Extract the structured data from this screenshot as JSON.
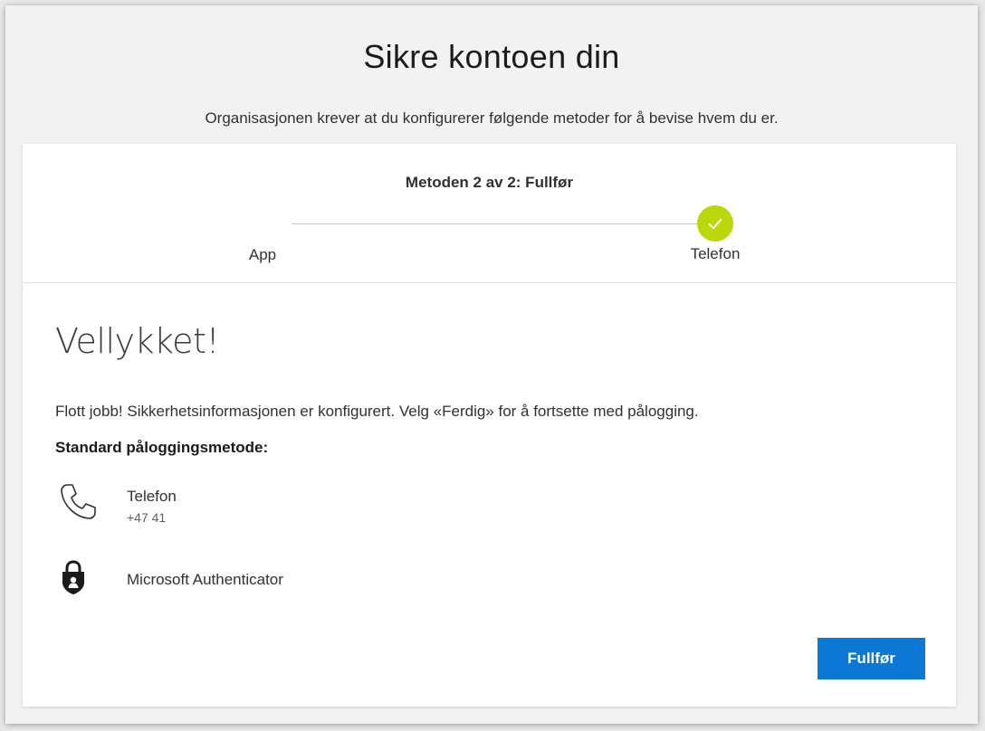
{
  "page": {
    "title": "Sikre kontoen din",
    "subtitle": "Organisasjonen krever at du konfigurerer følgende metoder for å bevise hvem du er."
  },
  "progress": {
    "step_title": "Metoden 2 av 2: Fullfør",
    "steps": [
      {
        "label": "App",
        "completed": true
      },
      {
        "label": "Telefon",
        "completed": true,
        "current": true
      }
    ],
    "check_color": "#bad80a"
  },
  "content": {
    "heading": "Vellykket!",
    "message": "Flott jobb! Sikkerhetsinformasjonen er konfigurert. Velg «Ferdig» for å fortsette med pålogging.",
    "default_method_label": "Standard påloggingsmetode:",
    "methods": [
      {
        "icon": "phone-icon",
        "name": "Telefon",
        "detail": "+47 41"
      },
      {
        "icon": "authenticator-lock-icon",
        "name": "Microsoft Authenticator"
      }
    ]
  },
  "actions": {
    "finish_label": "Fullfør",
    "finish_color": "#0a78d4"
  }
}
